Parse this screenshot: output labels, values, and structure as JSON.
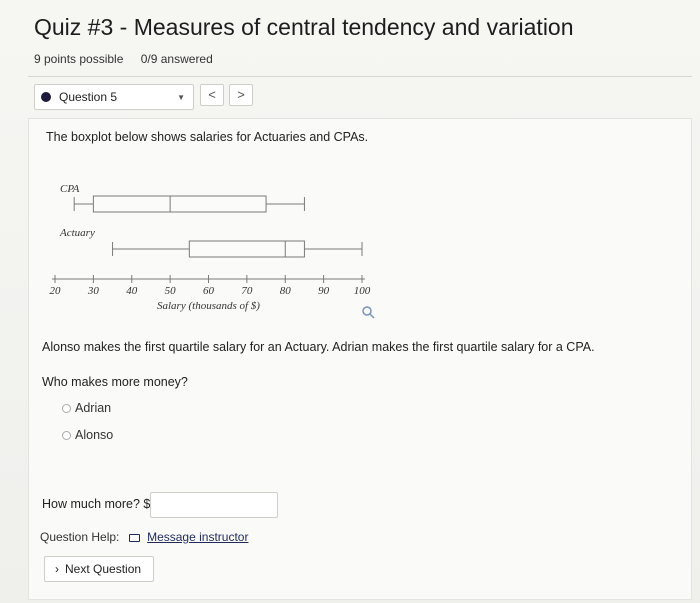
{
  "header": {
    "title": "Quiz #3 - Measures of central tendency and variation",
    "points": "9 points possible",
    "answered": "0/9 answered"
  },
  "nav": {
    "question_label": "Question 5",
    "prev": "<",
    "next": ">"
  },
  "question": {
    "intro": "The boxplot below shows salaries for Actuaries and CPAs.",
    "statement": "Alonso makes the first quartile salary for an Actuary. Adrian makes the first quartile salary for a CPA.",
    "ask": "Who makes more money?",
    "options": [
      "Adrian",
      "Alonso"
    ],
    "how_much_label": "How much more? $",
    "answer_value": ""
  },
  "help": {
    "label": "Question Help:",
    "link": "Message instructor"
  },
  "next_question": "Next Question",
  "chart_data": {
    "type": "boxplot",
    "xlabel": "Salary (thousands of $)",
    "xlim": [
      20,
      100
    ],
    "ticks": [
      "20",
      "30",
      "40",
      "50",
      "60",
      "70",
      "80",
      "90",
      "100"
    ],
    "series": [
      {
        "name": "CPA",
        "min": 25,
        "q1": 30,
        "median": 50,
        "q3": 75,
        "max": 85
      },
      {
        "name": "Actuary",
        "min": 35,
        "q1": 55,
        "median": 80,
        "q3": 85,
        "max": 100
      }
    ]
  }
}
